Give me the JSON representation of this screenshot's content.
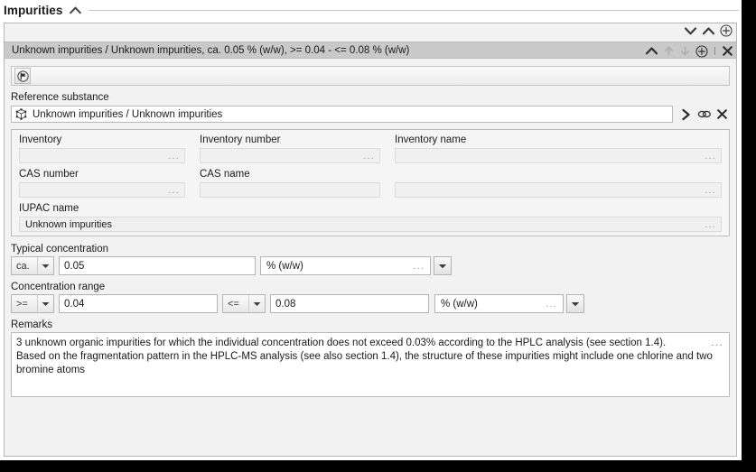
{
  "section": {
    "title": "Impurities",
    "collapse_icon": "chevron-up-icon"
  },
  "record": {
    "summary": "Unknown impurities / Unknown impurities, ca. 0.05 % (w/w), >= 0.04 - <= 0.08 % (w/w)",
    "nav_icons": [
      "chevron-down-icon",
      "chevron-up-icon",
      "plus-circle-icon"
    ],
    "strip_icons": [
      "chevron-up-icon",
      "arrow-up-icon",
      "arrow-down-icon",
      "plus-circle-icon",
      "close-icon"
    ]
  },
  "toolbar": {
    "flag_icon": "flag-icon"
  },
  "reference_substance": {
    "label": "Reference substance",
    "icon": "molecule-cube-icon",
    "value": "Unknown impurities / Unknown impurities",
    "actions": [
      "chevron-right-icon",
      "link-icon",
      "close-icon"
    ]
  },
  "inventory": {
    "fields": [
      {
        "label": "Inventory",
        "value": "",
        "dots": "..."
      },
      {
        "label": "Inventory number",
        "value": "",
        "dots": "..."
      },
      {
        "label": "Inventory name",
        "value": "",
        "dots": "..."
      },
      {
        "label": "CAS number",
        "value": "",
        "dots": "..."
      },
      {
        "label": "CAS name",
        "value": "",
        "dots": ""
      },
      {
        "label": "",
        "value": "",
        "dots": "..."
      }
    ],
    "iupac": {
      "label": "IUPAC name",
      "value": "Unknown impurities",
      "dots": "..."
    }
  },
  "typical_concentration": {
    "label": "Typical concentration",
    "qualifier": "ca.",
    "value": "0.05",
    "unit": "% (w/w)",
    "dots": "...",
    "dropdown_icon": "chevron-down-icon"
  },
  "concentration_range": {
    "label": "Concentration range",
    "lower_qualifier": ">=",
    "lower_value": "0.04",
    "upper_qualifier": "<=",
    "upper_value": "0.08",
    "unit": "% (w/w)",
    "dots": "...",
    "dropdown_icon": "chevron-down-icon"
  },
  "remarks": {
    "label": "Remarks",
    "lines": [
      "3 unknown organic impurities for which the individual concentration does not exceed  0.03% according to the HPLC analysis (see section 1.4).",
      "Based on the fragmentation pattern in the HPLC-MS analysis (see also section 1.4), the structure of these impurities might include one chlorine and two",
      "bromine atoms"
    ],
    "dots": "..."
  },
  "colors": {
    "panel_bg": "#f2f2f2",
    "selected_row": "#c9c9c9",
    "border": "#b6b6b6",
    "field_bg": "#ffffff",
    "readonly_bg": "#f0f0f0",
    "text": "#1a1a1a",
    "muted": "#9a9a9a",
    "backdrop": "#000000"
  }
}
